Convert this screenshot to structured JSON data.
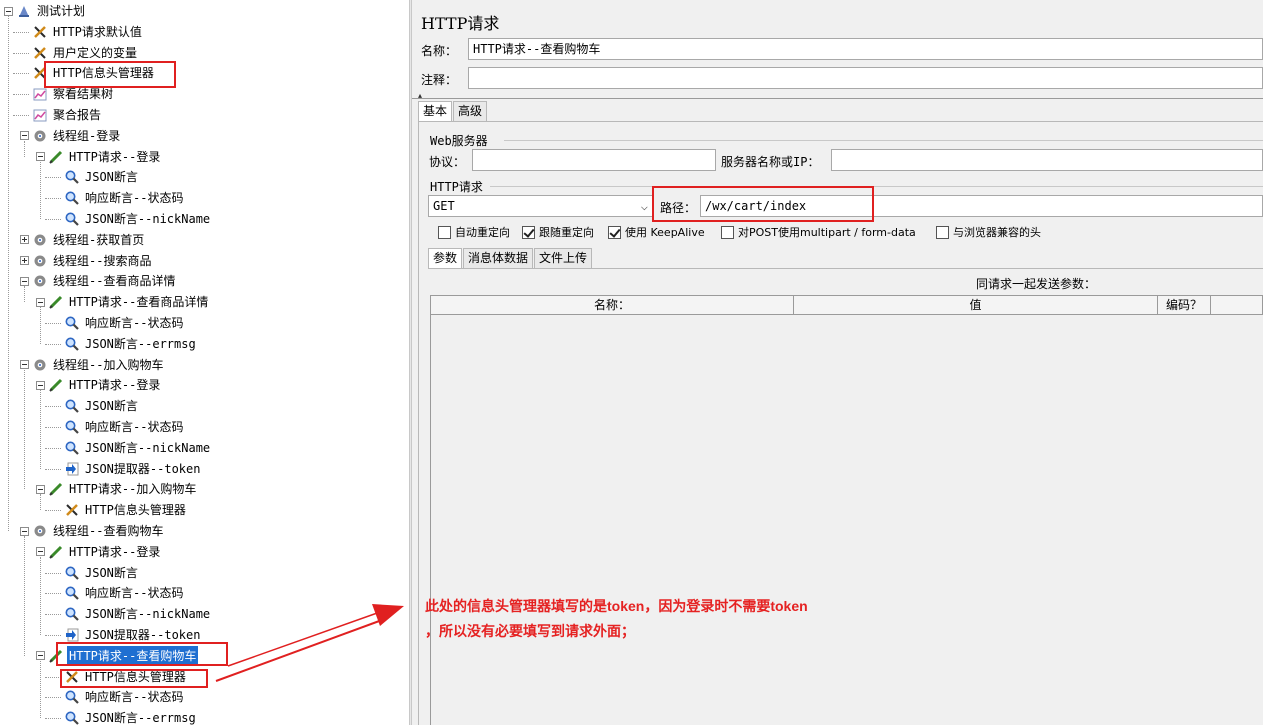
{
  "tree": {
    "nodes": [
      {
        "label": "测试计划",
        "icon": "test-plan-icon",
        "toggle": "minus"
      },
      {
        "label": "HTTP请求默认值",
        "icon": "config-tools-icon"
      },
      {
        "label": "用户定义的变量",
        "icon": "config-tools-icon"
      },
      {
        "label": "HTTP信息头管理器",
        "icon": "config-tools-icon"
      },
      {
        "label": "察看结果树",
        "icon": "listener-chart-icon"
      },
      {
        "label": "聚合报告",
        "icon": "listener-chart-icon"
      },
      {
        "label": "线程组-登录",
        "icon": "thread-group-gear-icon",
        "toggle": "minus"
      },
      {
        "label": "HTTP请求--登录",
        "icon": "sampler-pen-icon",
        "toggle": "minus"
      },
      {
        "label": "JSON断言",
        "icon": "assertion-magnifier-icon"
      },
      {
        "label": "响应断言--状态码",
        "icon": "assertion-magnifier-icon"
      },
      {
        "label": "JSON断言--nickName",
        "icon": "assertion-magnifier-icon"
      },
      {
        "label": "线程组-获取首页",
        "icon": "thread-group-gear-icon",
        "toggle": "plus"
      },
      {
        "label": "线程组--搜索商品",
        "icon": "thread-group-gear-icon",
        "toggle": "plus"
      },
      {
        "label": "线程组--查看商品详情",
        "icon": "thread-group-gear-icon",
        "toggle": "minus"
      },
      {
        "label": "HTTP请求--查看商品详情",
        "icon": "sampler-pen-icon",
        "toggle": "minus"
      },
      {
        "label": "响应断言--状态码",
        "icon": "assertion-magnifier-icon"
      },
      {
        "label": "JSON断言--errmsg",
        "icon": "assertion-magnifier-icon"
      },
      {
        "label": "线程组--加入购物车",
        "icon": "thread-group-gear-icon",
        "toggle": "minus"
      },
      {
        "label": "HTTP请求--登录",
        "icon": "sampler-pen-icon",
        "toggle": "minus"
      },
      {
        "label": "JSON断言",
        "icon": "assertion-magnifier-icon"
      },
      {
        "label": "响应断言--状态码",
        "icon": "assertion-magnifier-icon"
      },
      {
        "label": "JSON断言--nickName",
        "icon": "assertion-magnifier-icon"
      },
      {
        "label": "JSON提取器--token",
        "icon": "extractor-arrow-icon"
      },
      {
        "label": "HTTP请求--加入购物车",
        "icon": "sampler-pen-icon",
        "toggle": "minus"
      },
      {
        "label": "HTTP信息头管理器",
        "icon": "config-tools-icon"
      },
      {
        "label": "线程组--查看购物车",
        "icon": "thread-group-gear-icon",
        "toggle": "minus"
      },
      {
        "label": "HTTP请求--登录",
        "icon": "sampler-pen-icon",
        "toggle": "minus"
      },
      {
        "label": "JSON断言",
        "icon": "assertion-magnifier-icon"
      },
      {
        "label": "响应断言--状态码",
        "icon": "assertion-magnifier-icon"
      },
      {
        "label": "JSON断言--nickName",
        "icon": "assertion-magnifier-icon"
      },
      {
        "label": "JSON提取器--token",
        "icon": "extractor-arrow-icon"
      },
      {
        "label": "HTTP请求--查看购物车",
        "icon": "sampler-pen-icon",
        "toggle": "minus",
        "selected": true
      },
      {
        "label": "HTTP信息头管理器",
        "icon": "config-tools-icon"
      },
      {
        "label": "响应断言--状态码",
        "icon": "assertion-magnifier-icon"
      },
      {
        "label": "JSON断言--errmsg",
        "icon": "assertion-magnifier-icon"
      }
    ]
  },
  "panel": {
    "title": "HTTP请求",
    "name_label": "名称：",
    "name_value": "HTTP请求--查看购物车",
    "comment_label": "注释：",
    "comment_value": "",
    "tabs": [
      "基本",
      "高级"
    ],
    "web_server": {
      "group_label": "Web服务器",
      "protocol_label": "协议：",
      "protocol_value": "",
      "server_label": "服务器名称或IP：",
      "server_value": ""
    },
    "http_request": {
      "group_label": "HTTP请求",
      "method": "GET",
      "path_label": "路径：",
      "path_value": "/wx/cart/index"
    },
    "options": [
      {
        "label": "自动重定向",
        "checked": false
      },
      {
        "label": "跟随重定向",
        "checked": true
      },
      {
        "label": "使用 KeepAlive",
        "checked": true
      },
      {
        "label": "对POST使用multipart / form-data",
        "checked": false
      },
      {
        "label": "与浏览器兼容的头",
        "checked": false
      }
    ],
    "param_tabs": [
      "参数",
      "消息体数据",
      "文件上传"
    ],
    "params_caption": "同请求一起发送参数：",
    "columns": [
      "名称：",
      "值",
      "编码？"
    ]
  },
  "annotation": {
    "line1": "此处的信息头管理器填写的是token，因为登录时不需要token",
    "line2": "，所以没有必要填写到请求外面；",
    "color": "#e52222"
  }
}
